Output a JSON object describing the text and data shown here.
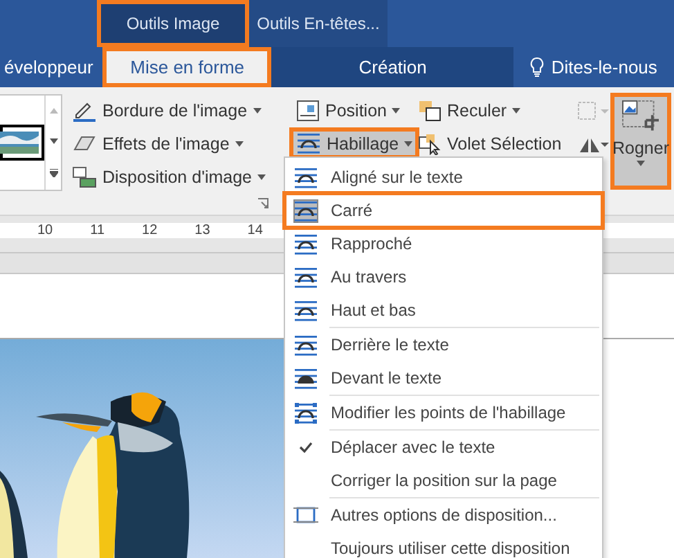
{
  "context_tabs": [
    {
      "label": "Outils Image",
      "selected": true,
      "highlighted": true
    },
    {
      "label": "Outils En-têtes...",
      "selected": false,
      "highlighted": false
    }
  ],
  "ribbon_tabs": [
    {
      "label": "éveloppeur",
      "selected": false,
      "highlighted": false
    },
    {
      "label": "Mise en forme",
      "selected": true,
      "highlighted": true
    },
    {
      "label": "Création",
      "selected": false,
      "highlighted": false
    }
  ],
  "tell_me": "Dites-le-nous",
  "picture_styles": [
    {
      "label": "Bordure de l'image"
    },
    {
      "label": "Effets de l'image"
    },
    {
      "label": "Disposition d'image"
    }
  ],
  "arrange": [
    {
      "label": "Position",
      "pressed": false,
      "highlighted": false
    },
    {
      "label": "Reculer",
      "pressed": false,
      "highlighted": false
    },
    {
      "label": "Habillage",
      "pressed": true,
      "highlighted": true
    },
    {
      "label": "Volet Sélection",
      "pressed": false,
      "highlighted": false
    }
  ],
  "crop_button": {
    "label": "Rogner",
    "highlighted": true
  },
  "ruler": [
    "10",
    "11",
    "12",
    "13",
    "14"
  ],
  "wrap_menu": {
    "groups": [
      {
        "items": [
          {
            "kind": "wrap",
            "label": "Aligné sur le texte",
            "selected": false,
            "highlighted": false
          },
          {
            "kind": "wrap",
            "label": "Carré",
            "selected": true,
            "highlighted": true
          },
          {
            "kind": "wrap",
            "label": "Rapproché",
            "selected": false,
            "highlighted": false
          },
          {
            "kind": "wrap",
            "label": "Au travers",
            "selected": false,
            "highlighted": false
          },
          {
            "kind": "wrap",
            "label": "Haut et bas",
            "selected": false,
            "highlighted": false
          }
        ]
      },
      {
        "items": [
          {
            "kind": "wrap",
            "label": "Derrière le texte",
            "selected": false,
            "highlighted": false
          },
          {
            "kind": "wrap",
            "label": "Devant le texte",
            "selected": false,
            "highlighted": false
          }
        ]
      },
      {
        "items": [
          {
            "kind": "command",
            "label": "Modifier les points de l'habillage"
          }
        ]
      },
      {
        "items": [
          {
            "kind": "toggle",
            "label": "Déplacer avec le texte",
            "checked": true
          },
          {
            "kind": "toggle",
            "label": "Corriger la position sur la page",
            "checked": false
          }
        ]
      },
      {
        "items": [
          {
            "kind": "command",
            "label": "Autres options de disposition..."
          },
          {
            "kind": "command",
            "label": "Toujours utiliser cette disposition"
          }
        ]
      }
    ]
  }
}
